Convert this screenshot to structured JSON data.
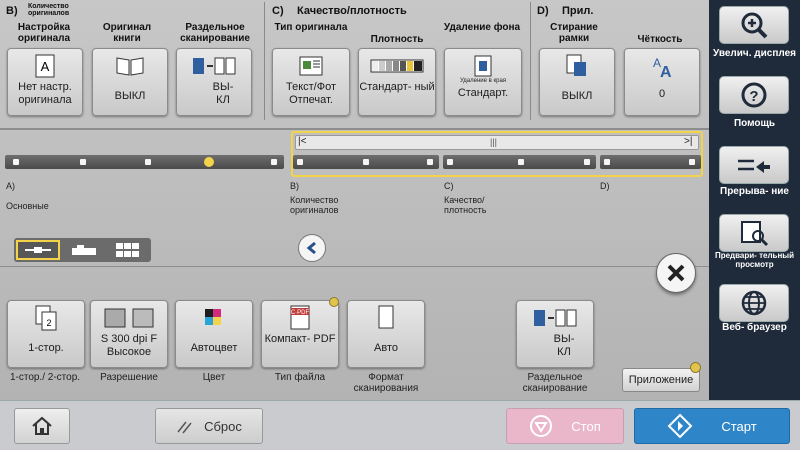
{
  "sections": {
    "b": {
      "label": "B)",
      "sublabel": "Количество оригиналов"
    },
    "c": {
      "label": "C)",
      "title": "Качество/плотность"
    },
    "d": {
      "label": "D)",
      "title": "Прил."
    }
  },
  "top_buttons": [
    {
      "label": "Настройка оригинала",
      "value": "Нет настр. оригинала",
      "icon": "document-a-icon"
    },
    {
      "label": "Оригинал книги",
      "value": "ВЫКЛ",
      "icon": "book-icon"
    },
    {
      "label": "Раздельное сканирование",
      "value": "ВЫ- КЛ",
      "icon": "separate-scan-icon"
    },
    {
      "label": "Тип оригинала",
      "value": "Текст/Фот Отпечат.",
      "icon": "text-photo-icon"
    },
    {
      "label": "Плотность",
      "value": "Стандарт- ный",
      "icon": "density-icon"
    },
    {
      "label": "Удаление фона",
      "value": "Стандарт.",
      "icon": "background-removal-icon",
      "icon_text": "Удаление в края"
    },
    {
      "label": "Стирание рамки",
      "value": "ВЫКЛ",
      "icon": "frame-erase-icon"
    },
    {
      "label": "Чёткость",
      "value": "0",
      "icon": "sharpness-icon"
    }
  ],
  "slider": {
    "left_arrow": "|<",
    "right_arrow": ">|",
    "thumb": "|||",
    "labels": [
      {
        "letter": "A)",
        "text": "Основные"
      },
      {
        "letter": "B)",
        "text": "Количество оригиналов"
      },
      {
        "letter": "C)",
        "text": "Качество/ плотность"
      },
      {
        "letter": "D)",
        "text": ""
      }
    ]
  },
  "bottom_functions": [
    {
      "value": "1-стор.",
      "caption": "1-стор./ 2-стор.",
      "icon": "duplex-icon"
    },
    {
      "value": "S 300 dpi F Высокое",
      "caption": "Разрешение",
      "icon": "resolution-icon"
    },
    {
      "value": "Автоцвет",
      "caption": "Цвет",
      "icon": "color-icon"
    },
    {
      "value": "Компакт- PDF",
      "caption": "Тип файла",
      "icon": "pdf-icon",
      "icon_text": "C·PDF"
    },
    {
      "value": "Авто",
      "caption": "Формат сканирования",
      "icon": "page-icon"
    },
    {
      "value": "ВЫ- КЛ",
      "caption": "Раздельное сканирование",
      "icon": "separate-scan-icon"
    }
  ],
  "application_button": "Приложение",
  "sidebar": [
    {
      "label": "Увелич. дисплея",
      "icon": "magnifier-plus-icon"
    },
    {
      "label": "Помощь",
      "icon": "help-icon"
    },
    {
      "label": "Прерыва- ние",
      "icon": "interrupt-icon"
    },
    {
      "label": "Предвари- тельный просмотр",
      "icon": "preview-icon"
    },
    {
      "label": "Веб- браузер",
      "icon": "globe-icon"
    }
  ],
  "footer": {
    "home_icon": "home-icon",
    "reset": "Сброс",
    "stop": "Стоп",
    "start": "Старт"
  },
  "colors": {
    "accent_yellow": "#f2d34a",
    "stop_pink": "#e9b7c9",
    "start_blue": "#2e86c9",
    "sidebar_dark": "#1f2a3a"
  }
}
